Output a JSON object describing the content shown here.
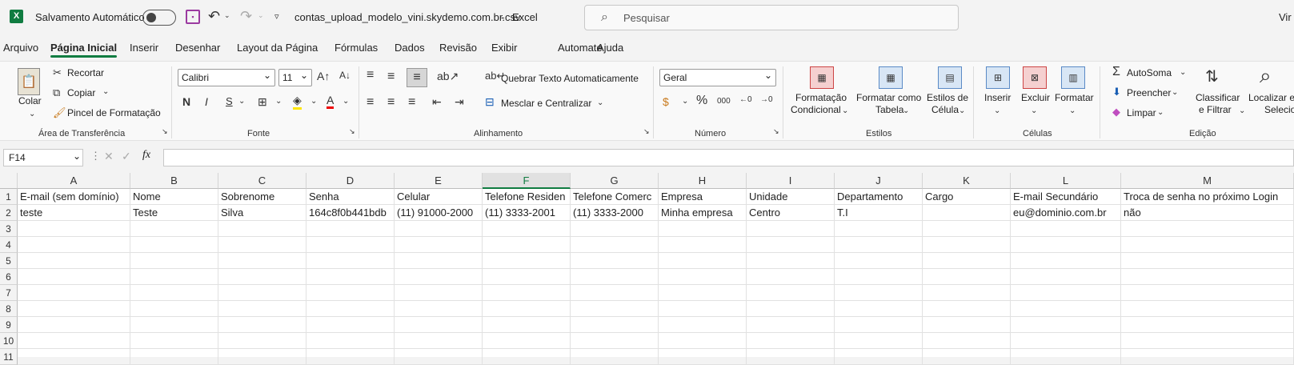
{
  "titlebar": {
    "autosave_label": "Salvamento Automático",
    "filename": "contas_upload_modelo_vini.skydemo.com.br.csv",
    "sep": "-",
    "app": "Excel",
    "search_placeholder": "Pesquisar",
    "user": "Vir"
  },
  "tabs": [
    "Arquivo",
    "Página Inicial",
    "Inserir",
    "Desenhar",
    "Layout da Página",
    "Fórmulas",
    "Dados",
    "Revisão",
    "Exibir",
    "Automate",
    "Ajuda"
  ],
  "ribbon": {
    "clipboard": {
      "paste": "Colar",
      "cut": "Recortar",
      "copy": "Copiar",
      "format_painter": "Pincel de Formatação",
      "group": "Área de Transferência"
    },
    "font": {
      "name": "Calibri",
      "size": "11",
      "group": "Fonte"
    },
    "alignment": {
      "wrap": "Quebrar Texto Automaticamente",
      "merge": "Mesclar e Centralizar",
      "group": "Alinhamento"
    },
    "number": {
      "format": "Geral",
      "group": "Número"
    },
    "styles": {
      "conditional": "Formatação",
      "conditional2": "Condicional",
      "as_table": "Formatar como",
      "as_table2": "Tabela",
      "cell_styles": "Estilos de",
      "cell_styles2": "Célula",
      "group": "Estilos"
    },
    "cells": {
      "insert": "Inserir",
      "delete": "Excluir",
      "format": "Formatar",
      "group": "Células"
    },
    "editing": {
      "autosum": "AutoSoma",
      "fill": "Preencher",
      "clear": "Limpar",
      "sort": "Classificar",
      "sort2": "e Filtrar",
      "find": "Localizar e",
      "find2": "Selecionar",
      "group": "Edição"
    }
  },
  "formula_bar": {
    "namebox": "F14",
    "fx": "fx",
    "value": ""
  },
  "sheet": {
    "columns": [
      "A",
      "B",
      "C",
      "D",
      "E",
      "F",
      "G",
      "H",
      "I",
      "J",
      "K",
      "L",
      "M"
    ],
    "selected_column": "F",
    "rows": [
      "1",
      "2",
      "3",
      "4",
      "5",
      "6",
      "7",
      "8",
      "9",
      "10",
      "11"
    ],
    "data": [
      [
        "E-mail (sem domínio)",
        "Nome",
        "Sobrenome",
        "Senha",
        "Celular",
        "Telefone Residen",
        "Telefone Comerc",
        "Empresa",
        "Unidade",
        "Departamento",
        "Cargo",
        "E-mail Secundário",
        "Troca de senha no próximo Login"
      ],
      [
        "teste",
        "Teste",
        "Silva",
        "164c8f0b441bdb",
        "(11) 91000-2000",
        "(11) 3333-2001",
        "(11) 3333-2000",
        "Minha empresa",
        "Centro",
        "T.I",
        "",
        "eu@dominio.com.br",
        "não"
      ]
    ]
  }
}
